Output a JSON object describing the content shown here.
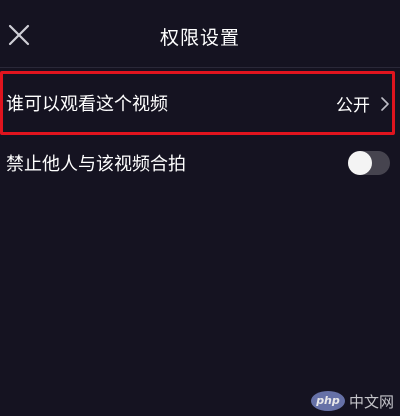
{
  "header": {
    "title": "权限设置",
    "close_icon": "close-icon"
  },
  "settings": [
    {
      "label": "谁可以观看这个视频",
      "value": "公开",
      "icon": "chevron-right-icon",
      "highlighted": true
    },
    {
      "label": "禁止他人与该视频合拍",
      "toggle_on": false
    }
  ],
  "watermark": {
    "logo_text": "php",
    "text": "中文网"
  },
  "colors": {
    "background": "#151321",
    "highlight": "#e0141e",
    "toggle_track": "#46444f",
    "toggle_knob": "#f4f4f4"
  }
}
